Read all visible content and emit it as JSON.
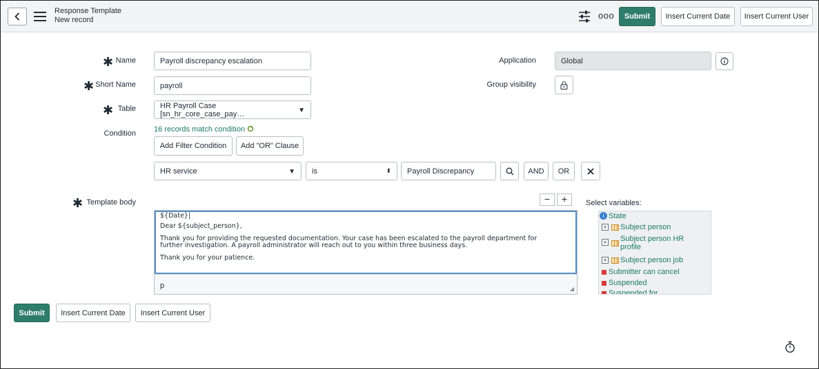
{
  "header": {
    "title": "Response Template",
    "subtitle": "New record",
    "submit_label": "Submit",
    "insert_date_label": "Insert Current Date",
    "insert_user_label": "Insert Current User",
    "more_label": "ooo"
  },
  "form": {
    "name": {
      "label": "Name",
      "value": "Payroll discrepancy escalation"
    },
    "short_name": {
      "label": "Short Name",
      "value": "payroll"
    },
    "table": {
      "label": "Table",
      "value": "HR Payroll Case [sn_hr_core_case_pay…"
    },
    "condition": {
      "label": "Condition",
      "match_text": "16 records match condition",
      "add_filter_label": "Add Filter Condition",
      "add_or_label": "Add \"OR\" Clause",
      "field": "HR service",
      "operator": "is",
      "value": "Payroll Discrepancy",
      "and_label": "AND",
      "or_label": "OR"
    },
    "application": {
      "label": "Application",
      "value": "Global"
    },
    "group_visibility": {
      "label": "Group visibility"
    },
    "template_body": {
      "label": "Template body",
      "line1": "${Date}|",
      "line2": "Dear ${subject_person},",
      "line3": "Thank you for providing the requested documentation. Your case has been escalated to the payroll department for",
      "line4": "further investigation. A payroll administrator will reach out to you within three business days.",
      "line5": "Thank you for your patience.",
      "footer": "p",
      "minus": "−",
      "plus": "+"
    },
    "variables": {
      "label": "Select variables:",
      "items": [
        {
          "label": "State"
        },
        {
          "label": "Subject person"
        },
        {
          "label": "Subject person HR",
          "label2": "profile"
        },
        {
          "label": "Subject person job"
        },
        {
          "label": "Submitter can cancel"
        },
        {
          "label": "Suspended"
        },
        {
          "label": "Suspended for"
        }
      ]
    }
  },
  "footer": {
    "submit_label": "Submit",
    "insert_date_label": "Insert Current Date",
    "insert_user_label": "Insert Current User"
  },
  "colors": {
    "primary": "#2e7d6b",
    "link": "#1b7a67",
    "header_bg": "#f3f4f5"
  }
}
